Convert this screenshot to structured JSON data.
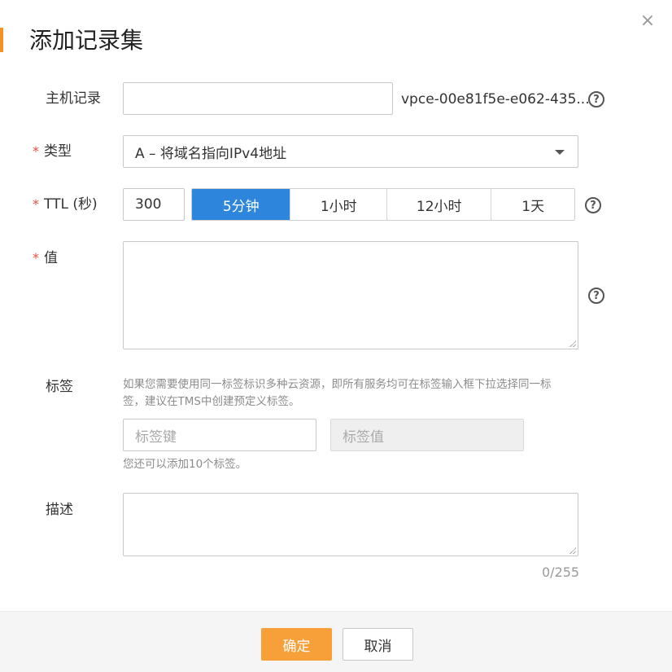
{
  "dialog": {
    "title": "添加记录集",
    "close_icon": "×"
  },
  "host_record": {
    "label": "主机记录",
    "value": "",
    "suffix": "vpce-00e81f5e-e062-435..."
  },
  "type": {
    "label": "类型",
    "selected": "A – 将域名指向IPv4地址"
  },
  "ttl": {
    "label": "TTL (秒)",
    "value": "300",
    "options": [
      {
        "label": "5分钟",
        "active": true
      },
      {
        "label": "1小时",
        "active": false
      },
      {
        "label": "12小时",
        "active": false
      },
      {
        "label": "1天",
        "active": false
      }
    ]
  },
  "value_field": {
    "label": "值",
    "value": ""
  },
  "tags": {
    "label": "标签",
    "hint_line1": "如果您需要使用同一标签标识多种云资源，即所有服务均可在标签输入框下拉选择同一标",
    "hint_line2": "签，建议在TMS中创建预定义标签。",
    "key_placeholder": "标签键",
    "value_placeholder": "标签值",
    "remaining": "您还可以添加10个标签。"
  },
  "description": {
    "label": "描述",
    "value": "",
    "counter": "0/255"
  },
  "footer": {
    "confirm_label": "确定",
    "cancel_label": "取消"
  },
  "required_mark": "*",
  "help_glyph": "?",
  "colors": {
    "accent": "#f39325",
    "primary_button": "#f7a03a",
    "active_segment": "#2d86db",
    "required": "#e84c3d"
  }
}
